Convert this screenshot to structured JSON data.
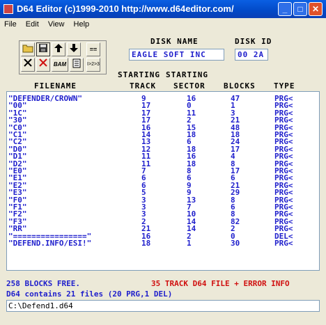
{
  "window": {
    "title": "D64 Editor (c)1999-2010   http://www.d64editor.com/",
    "min_label": "_",
    "max_label": "□",
    "close_label": "✕"
  },
  "menu": [
    "File",
    "Edit",
    "View",
    "Help"
  ],
  "toolbar": {
    "bam_label": "BAM",
    "equals_label": "==",
    "track_label": "I>2>3"
  },
  "disk": {
    "name_header": "DISK NAME",
    "id_header": "DISK ID",
    "name": "EAGLE SOFT INC",
    "id": "00 2A"
  },
  "columns": {
    "starting1": "STARTING",
    "starting2": "STARTING",
    "filename": "FILENAME",
    "track": "TRACK",
    "sector": "SECTOR",
    "blocks": "BLOCKS",
    "type": "TYPE"
  },
  "files": [
    {
      "name": "\"DEFENDER/CROWN\"",
      "track": "9",
      "sector": "16",
      "blocks": "47",
      "type": "PRG<"
    },
    {
      "name": "\"00\"",
      "track": "17",
      "sector": "0",
      "blocks": "1",
      "type": "PRG<"
    },
    {
      "name": "\"1C\"",
      "track": "17",
      "sector": "11",
      "blocks": "3",
      "type": "PRG<"
    },
    {
      "name": "\"30\"",
      "track": "17",
      "sector": "2",
      "blocks": "21",
      "type": "PRG<"
    },
    {
      "name": "\"C0\"",
      "track": "16",
      "sector": "15",
      "blocks": "48",
      "type": "PRG<"
    },
    {
      "name": "\"C1\"",
      "track": "14",
      "sector": "18",
      "blocks": "18",
      "type": "PRG<"
    },
    {
      "name": "\"C2\"",
      "track": "13",
      "sector": "6",
      "blocks": "24",
      "type": "PRG<"
    },
    {
      "name": "\"D0\"",
      "track": "12",
      "sector": "18",
      "blocks": "17",
      "type": "PRG<"
    },
    {
      "name": "\"D1\"",
      "track": "11",
      "sector": "16",
      "blocks": "4",
      "type": "PRG<"
    },
    {
      "name": "\"D2\"",
      "track": "11",
      "sector": "18",
      "blocks": "8",
      "type": "PRG<"
    },
    {
      "name": "\"E0\"",
      "track": "7",
      "sector": "8",
      "blocks": "17",
      "type": "PRG<"
    },
    {
      "name": "\"E1\"",
      "track": "6",
      "sector": "6",
      "blocks": "6",
      "type": "PRG<"
    },
    {
      "name": "\"E2\"",
      "track": "6",
      "sector": "9",
      "blocks": "21",
      "type": "PRG<"
    },
    {
      "name": "\"E3\"",
      "track": "5",
      "sector": "9",
      "blocks": "29",
      "type": "PRG<"
    },
    {
      "name": "\"F0\"",
      "track": "3",
      "sector": "13",
      "blocks": "8",
      "type": "PRG<"
    },
    {
      "name": "\"F1\"",
      "track": "3",
      "sector": "7",
      "blocks": "6",
      "type": "PRG<"
    },
    {
      "name": "\"F2\"",
      "track": "3",
      "sector": "10",
      "blocks": "8",
      "type": "PRG<"
    },
    {
      "name": "\"F3\"",
      "track": "2",
      "sector": "14",
      "blocks": "82",
      "type": "PRG<"
    },
    {
      "name": "\"RR\"",
      "track": "21",
      "sector": "14",
      "blocks": "2",
      "type": "PRG<"
    },
    {
      "name": "\"================\"",
      "track": "16",
      "sector": "2",
      "blocks": "0",
      "type": "DEL<"
    },
    {
      "name": "\"DEFEND.INFO/ESI!\"",
      "track": "18",
      "sector": "1",
      "blocks": "30",
      "type": "PRG<"
    }
  ],
  "status": {
    "blocks_free": "258 BLOCKS FREE.",
    "file_info": "35 TRACK D64 FILE + ERROR INFO",
    "summary": "D64 contains 21 files (20 PRG,1 DEL)",
    "path": "C:\\Defend1.d64"
  },
  "colors": {
    "text_blue": "#1f1fcc",
    "text_red": "#d01010",
    "title_blue": "#0249c7"
  }
}
